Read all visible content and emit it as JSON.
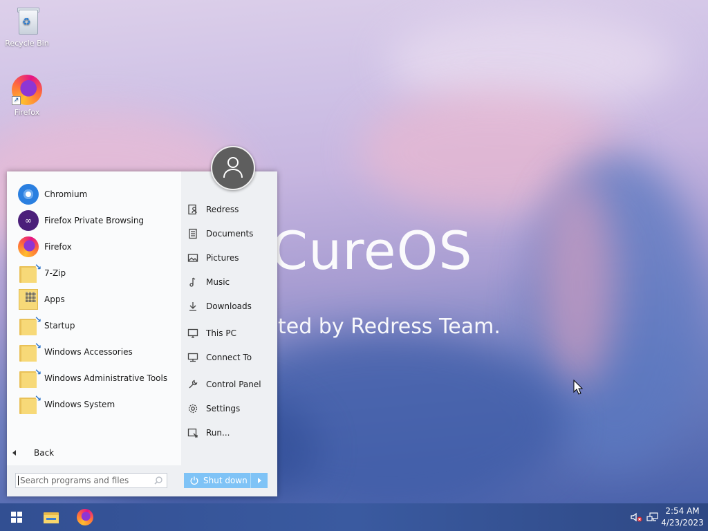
{
  "desktop": {
    "brand_text": "CureOS",
    "tagline": "ted by Redress Team.",
    "icons": [
      {
        "label": "Recycle Bin",
        "icon": "recycle-bin-icon"
      },
      {
        "label": "Firefox",
        "icon": "firefox-icon"
      }
    ]
  },
  "start_menu": {
    "programs": [
      {
        "label": "Chromium",
        "icon": "chromium-icon"
      },
      {
        "label": "Firefox Private Browsing",
        "icon": "firefox-private-icon"
      },
      {
        "label": "Firefox",
        "icon": "firefox-icon"
      },
      {
        "label": "7-Zip",
        "icon": "folder-icon"
      },
      {
        "label": "Apps",
        "icon": "apps-folder-icon"
      },
      {
        "label": "Startup",
        "icon": "folder-icon"
      },
      {
        "label": "Windows Accessories",
        "icon": "folder-icon"
      },
      {
        "label": "Windows Administrative Tools",
        "icon": "folder-icon"
      },
      {
        "label": "Windows System",
        "icon": "folder-icon"
      }
    ],
    "back_label": "Back",
    "places": [
      {
        "label": "Redress",
        "icon": "user-folder-icon"
      },
      {
        "label": "Documents",
        "icon": "document-icon"
      },
      {
        "label": "Pictures",
        "icon": "picture-icon"
      },
      {
        "label": "Music",
        "icon": "music-note-icon"
      },
      {
        "label": "Downloads",
        "icon": "download-icon"
      },
      {
        "label": "This PC",
        "icon": "computer-icon"
      },
      {
        "label": "Connect To",
        "icon": "network-icon"
      },
      {
        "label": "Control Panel",
        "icon": "wrench-icon"
      },
      {
        "label": "Settings",
        "icon": "gear-icon"
      },
      {
        "label": "Run...",
        "icon": "run-icon"
      }
    ],
    "search": {
      "placeholder": "Search programs and files"
    },
    "shutdown_label": "Shut down"
  },
  "taskbar": {
    "pinned": [
      {
        "name": "start",
        "icon": "windows-logo-icon"
      },
      {
        "name": "file-explorer",
        "icon": "folder-icon"
      },
      {
        "name": "firefox",
        "icon": "firefox-icon"
      }
    ],
    "tray": {
      "volume": "muted",
      "network": "ethernet-icon"
    },
    "clock": {
      "time": "2:54 AM",
      "date": "4/23/2023"
    }
  },
  "colors": {
    "taskbar": "#324f92",
    "shutdown_button": "#7fc3f6",
    "menu_left": "#fafbfc",
    "menu_right": "#eef0f3"
  }
}
